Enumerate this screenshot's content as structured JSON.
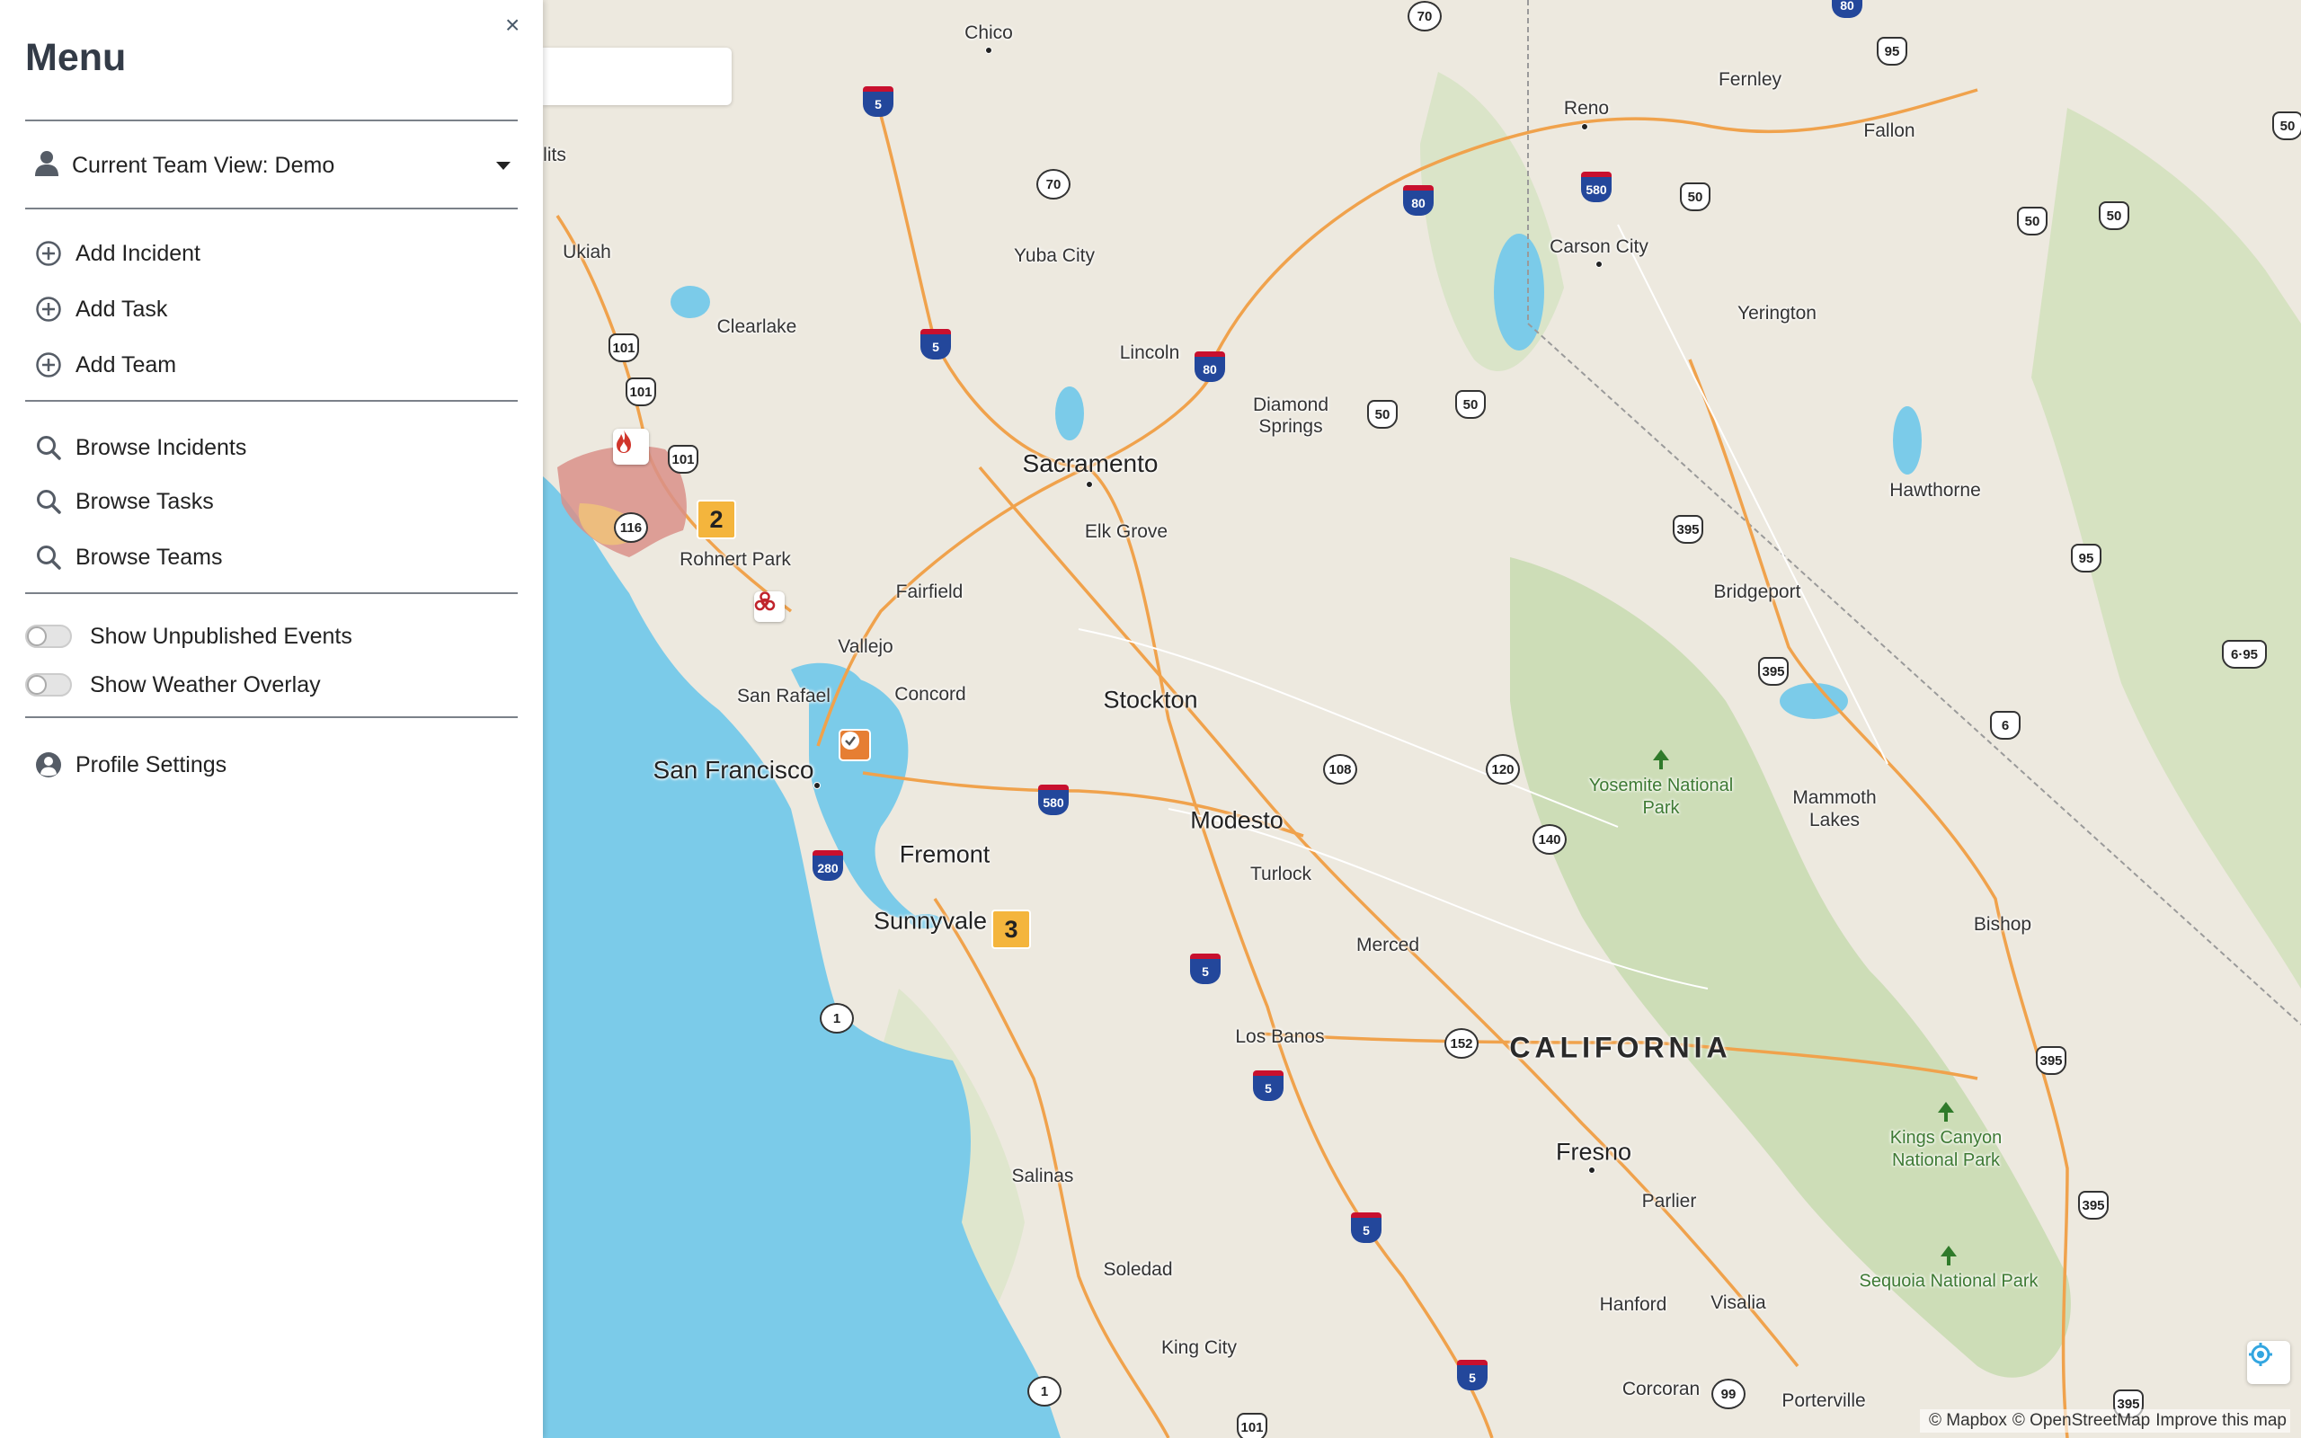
{
  "sidebar": {
    "title": "Menu",
    "close_label": "×",
    "team_view": "Current Team View: Demo",
    "add_items": [
      {
        "label": "Add Incident",
        "icon": "plus-circle-icon"
      },
      {
        "label": "Add Task",
        "icon": "plus-circle-icon"
      },
      {
        "label": "Add Team",
        "icon": "plus-circle-icon"
      }
    ],
    "browse_items": [
      {
        "label": "Browse Incidents",
        "icon": "search-icon"
      },
      {
        "label": "Browse Tasks",
        "icon": "search-icon"
      },
      {
        "label": "Browse Teams",
        "icon": "search-icon"
      }
    ],
    "toggles": [
      {
        "label": "Show Unpublished Events",
        "on": false
      },
      {
        "label": "Show Weather Overlay",
        "on": false
      }
    ],
    "profile": {
      "label": "Profile Settings",
      "icon": "user-circle-icon"
    }
  },
  "map": {
    "places": {
      "chico": "Chico",
      "reno": "Reno",
      "fernley": "Fernley",
      "fallon": "Fallon",
      "ukiah": "Ukiah",
      "yuba_city": "Yuba City",
      "carson_city": "Carson City",
      "clearlake": "Clearlake",
      "lincoln": "Lincoln",
      "yerington": "Yerington",
      "diamond_springs": "Diamond Springs",
      "sacramento": "Sacramento",
      "hawthorne": "Hawthorne",
      "elk_grove": "Elk Grove",
      "rohnert_park": "Rohnert Park",
      "bridgeport": "Bridgeport",
      "fairfield": "Fairfield",
      "vallejo": "Vallejo",
      "concord": "Concord",
      "san_rafael": "San Rafael",
      "stockton": "Stockton",
      "san_francisco": "San Francisco",
      "yosemite": "Yosemite National Park",
      "mammoth_lakes": "Mammoth Lakes",
      "modesto": "Modesto",
      "fremont": "Fremont",
      "turlock": "Turlock",
      "sunnyvale": "Sunnyvale",
      "bishop": "Bishop",
      "merced": "Merced",
      "los_banos": "Los Banos",
      "california": "CALIFORNIA",
      "kings_canyon": "Kings Canyon National Park",
      "fresno": "Fresno",
      "parlier": "Parlier",
      "salinas": "Salinas",
      "soledad": "Soledad",
      "sequoia": "Sequoia National Park",
      "hanford": "Hanford",
      "visalia": "Visalia",
      "king_city": "King City",
      "corcoran": "Corcoran",
      "porterville": "Porterville",
      "lits": "lits"
    },
    "shields": {
      "i5_a": "5",
      "i5_b": "5",
      "i5_c": "5",
      "i5_d": "5",
      "i5_e": "5",
      "i5_f": "5",
      "i80_a": "80",
      "i80_b": "80",
      "i80_c": "80",
      "i580_a": "580",
      "i580_b": "580",
      "i280": "280",
      "us95_a": "95",
      "us95_b": "95",
      "us50_a": "50",
      "us50_b": "50",
      "us50_c": "50",
      "us50_d": "50",
      "us50_e": "50",
      "us50_f": "50",
      "us101_a": "101",
      "us101_b": "101",
      "us101_c": "101",
      "us101_d": "101",
      "us395_a": "395",
      "us395_b": "395",
      "us395_c": "395",
      "us395_d": "395",
      "us395_e": "395",
      "us6": "6",
      "us695": "6·95",
      "sr70_a": "70",
      "sr70_b": "70",
      "sr116": "116",
      "sr108": "108",
      "sr120": "120",
      "sr140": "140",
      "sr152": "152",
      "sr1_a": "1",
      "sr1_b": "1",
      "sr99": "99"
    },
    "markers": {
      "cluster_2": "2",
      "cluster_3": "3"
    },
    "attribution": {
      "mapbox": "© Mapbox",
      "osm": "© OpenStreetMap",
      "improve": "Improve this map"
    }
  }
}
